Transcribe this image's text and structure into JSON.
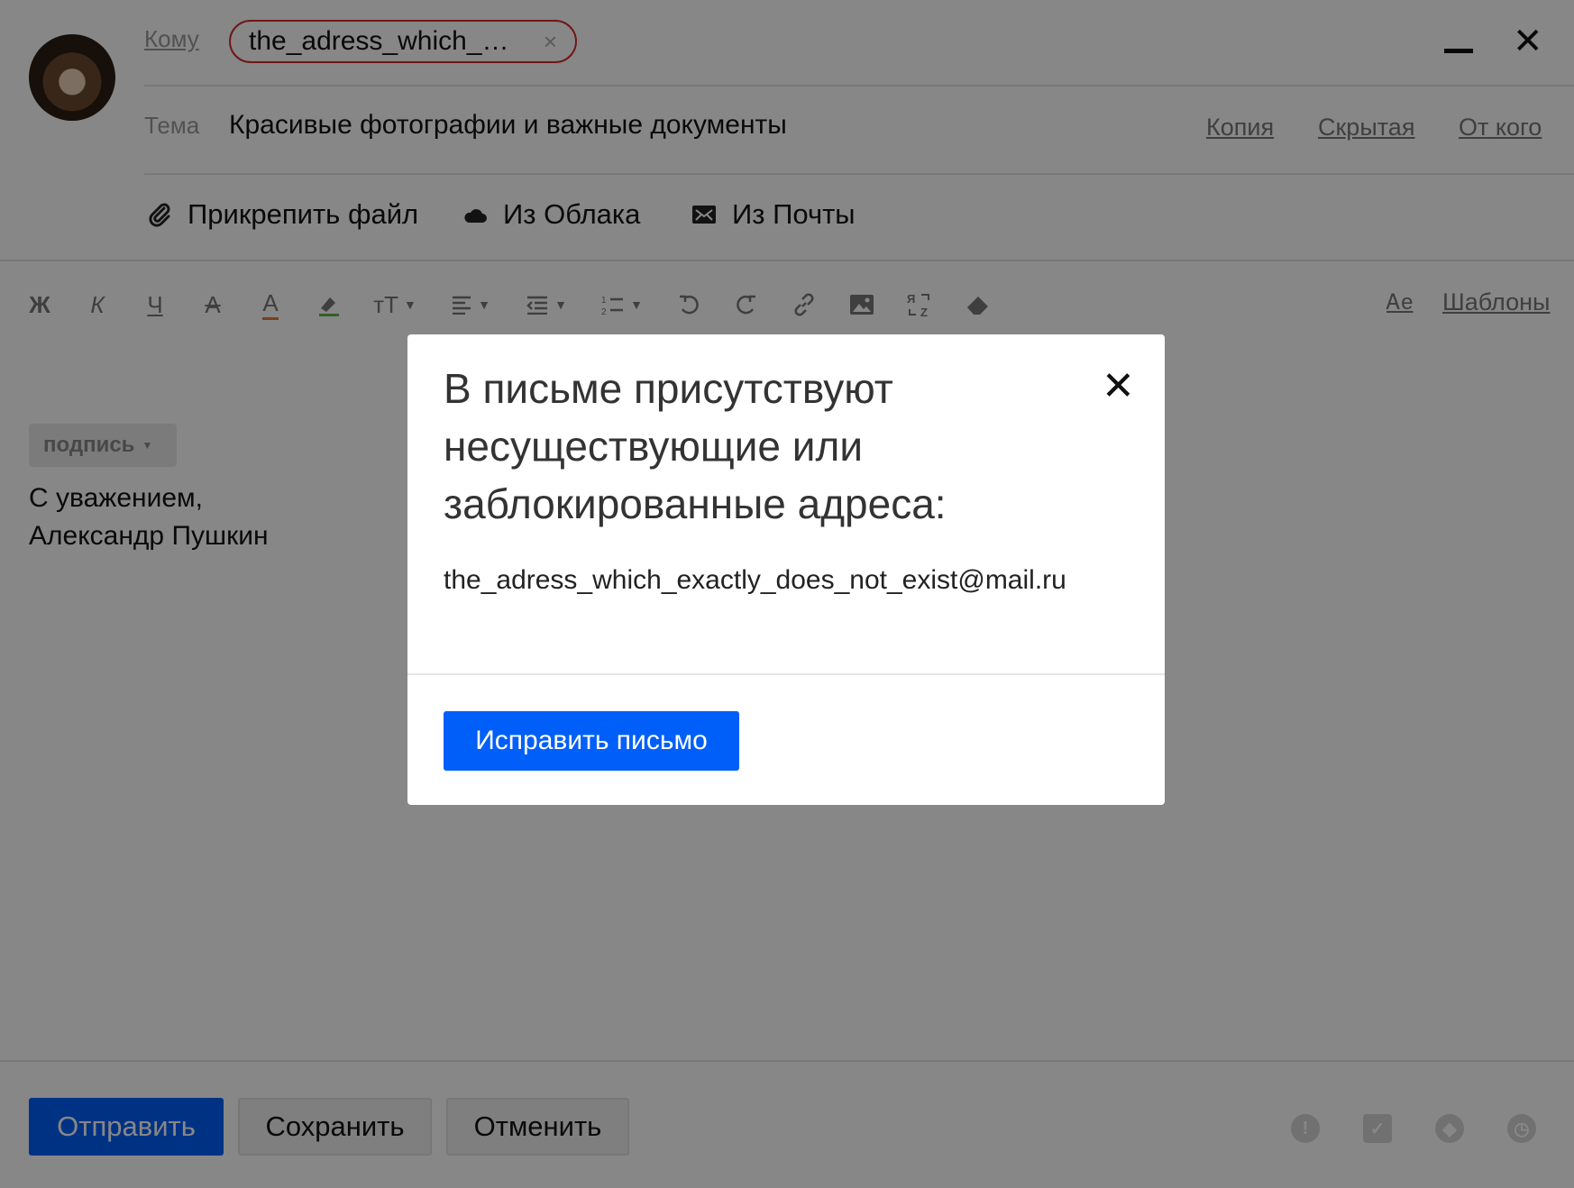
{
  "compose": {
    "to_label": "Кому",
    "recipient_chip": "the_adress_which_…",
    "recipient_remove": "×",
    "close": "✕",
    "subject_label": "Тема",
    "subject": "Красивые фотографии и важные документы",
    "copy_link": "Копия",
    "hidden_link": "Скрытая",
    "from_link": "От кого",
    "attach_file": "Прикрепить файл",
    "from_cloud": "Из Облака",
    "from_mail": "Из Почты"
  },
  "toolbar": {
    "bold": "Ж",
    "italic": "К",
    "underline": "Ч",
    "strike": "А",
    "text_color": "А",
    "font_size": "тТ",
    "templates_icon": "Ꭺe",
    "templates": "Шаблоны",
    "icons": [
      "highlighter-icon",
      "align-icon",
      "indent-icon",
      "list-icon",
      "undo-icon",
      "redo-icon",
      "link-icon",
      "image-icon",
      "translit-icon",
      "eraser-icon"
    ]
  },
  "signature": {
    "chip": "подпись",
    "line1": "С уважением,",
    "line2": "Александр Пушкин"
  },
  "footer": {
    "send": "Отправить",
    "save": "Сохранить",
    "cancel": "Отменить",
    "icons": [
      "important-icon",
      "receipt-icon",
      "reminder-icon",
      "schedule-icon"
    ]
  },
  "modal": {
    "title": "В письме присутствуют несуществующие или заблокированные адреса:",
    "address": "the_adress_which_exactly_does_not_exist@mail.ru",
    "fix_button": "Исправить письмо",
    "close": "✕"
  },
  "colors": {
    "accent": "#005ff9",
    "error": "#d52b2b",
    "overlay": "rgba(0,0,0,0.47)"
  }
}
